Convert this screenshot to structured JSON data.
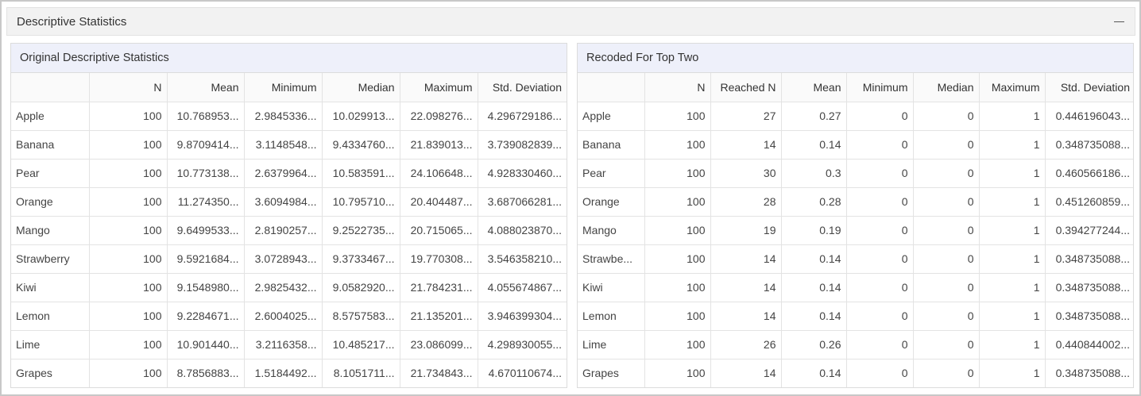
{
  "panel": {
    "title": "Descriptive Statistics"
  },
  "original": {
    "caption": "Original Descriptive Statistics",
    "columns": [
      "",
      "N",
      "Mean",
      "Minimum",
      "Median",
      "Maximum",
      "Std. Deviation"
    ],
    "rows": [
      [
        "Apple",
        "100",
        "10.768953...",
        "2.9845336...",
        "10.029913...",
        "22.098276...",
        "4.296729186..."
      ],
      [
        "Banana",
        "100",
        "9.8709414...",
        "3.1148548...",
        "9.4334760...",
        "21.839013...",
        "3.739082839..."
      ],
      [
        "Pear",
        "100",
        "10.773138...",
        "2.6379964...",
        "10.583591...",
        "24.106648...",
        "4.928330460..."
      ],
      [
        "Orange",
        "100",
        "11.274350...",
        "3.6094984...",
        "10.795710...",
        "20.404487...",
        "3.687066281..."
      ],
      [
        "Mango",
        "100",
        "9.6499533...",
        "2.8190257...",
        "9.2522735...",
        "20.715065...",
        "4.088023870..."
      ],
      [
        "Strawberry",
        "100",
        "9.5921684...",
        "3.0728943...",
        "9.3733467...",
        "19.770308...",
        "3.546358210..."
      ],
      [
        "Kiwi",
        "100",
        "9.1548980...",
        "2.9825432...",
        "9.0582920...",
        "21.784231...",
        "4.055674867..."
      ],
      [
        "Lemon",
        "100",
        "9.2284671...",
        "2.6004025...",
        "8.5757583...",
        "21.135201...",
        "3.946399304..."
      ],
      [
        "Lime",
        "100",
        "10.901440...",
        "3.2116358...",
        "10.485217...",
        "23.086099...",
        "4.298930055..."
      ],
      [
        "Grapes",
        "100",
        "8.7856883...",
        "1.5184492...",
        "8.1051711...",
        "21.734843...",
        "4.670110674..."
      ]
    ]
  },
  "recoded": {
    "caption": "Recoded For Top Two",
    "columns": [
      "",
      "N",
      "Reached N",
      "Mean",
      "Minimum",
      "Median",
      "Maximum",
      "Std. Deviation"
    ],
    "rows": [
      [
        "Apple",
        "100",
        "27",
        "0.27",
        "0",
        "0",
        "1",
        "0.446196043..."
      ],
      [
        "Banana",
        "100",
        "14",
        "0.14",
        "0",
        "0",
        "1",
        "0.348735088..."
      ],
      [
        "Pear",
        "100",
        "30",
        "0.3",
        "0",
        "0",
        "1",
        "0.460566186..."
      ],
      [
        "Orange",
        "100",
        "28",
        "0.28",
        "0",
        "0",
        "1",
        "0.451260859..."
      ],
      [
        "Mango",
        "100",
        "19",
        "0.19",
        "0",
        "0",
        "1",
        "0.394277244..."
      ],
      [
        "Strawbe...",
        "100",
        "14",
        "0.14",
        "0",
        "0",
        "1",
        "0.348735088..."
      ],
      [
        "Kiwi",
        "100",
        "14",
        "0.14",
        "0",
        "0",
        "1",
        "0.348735088..."
      ],
      [
        "Lemon",
        "100",
        "14",
        "0.14",
        "0",
        "0",
        "1",
        "0.348735088..."
      ],
      [
        "Lime",
        "100",
        "26",
        "0.26",
        "0",
        "0",
        "1",
        "0.440844002..."
      ],
      [
        "Grapes",
        "100",
        "14",
        "0.14",
        "0",
        "0",
        "1",
        "0.348735088..."
      ]
    ]
  }
}
